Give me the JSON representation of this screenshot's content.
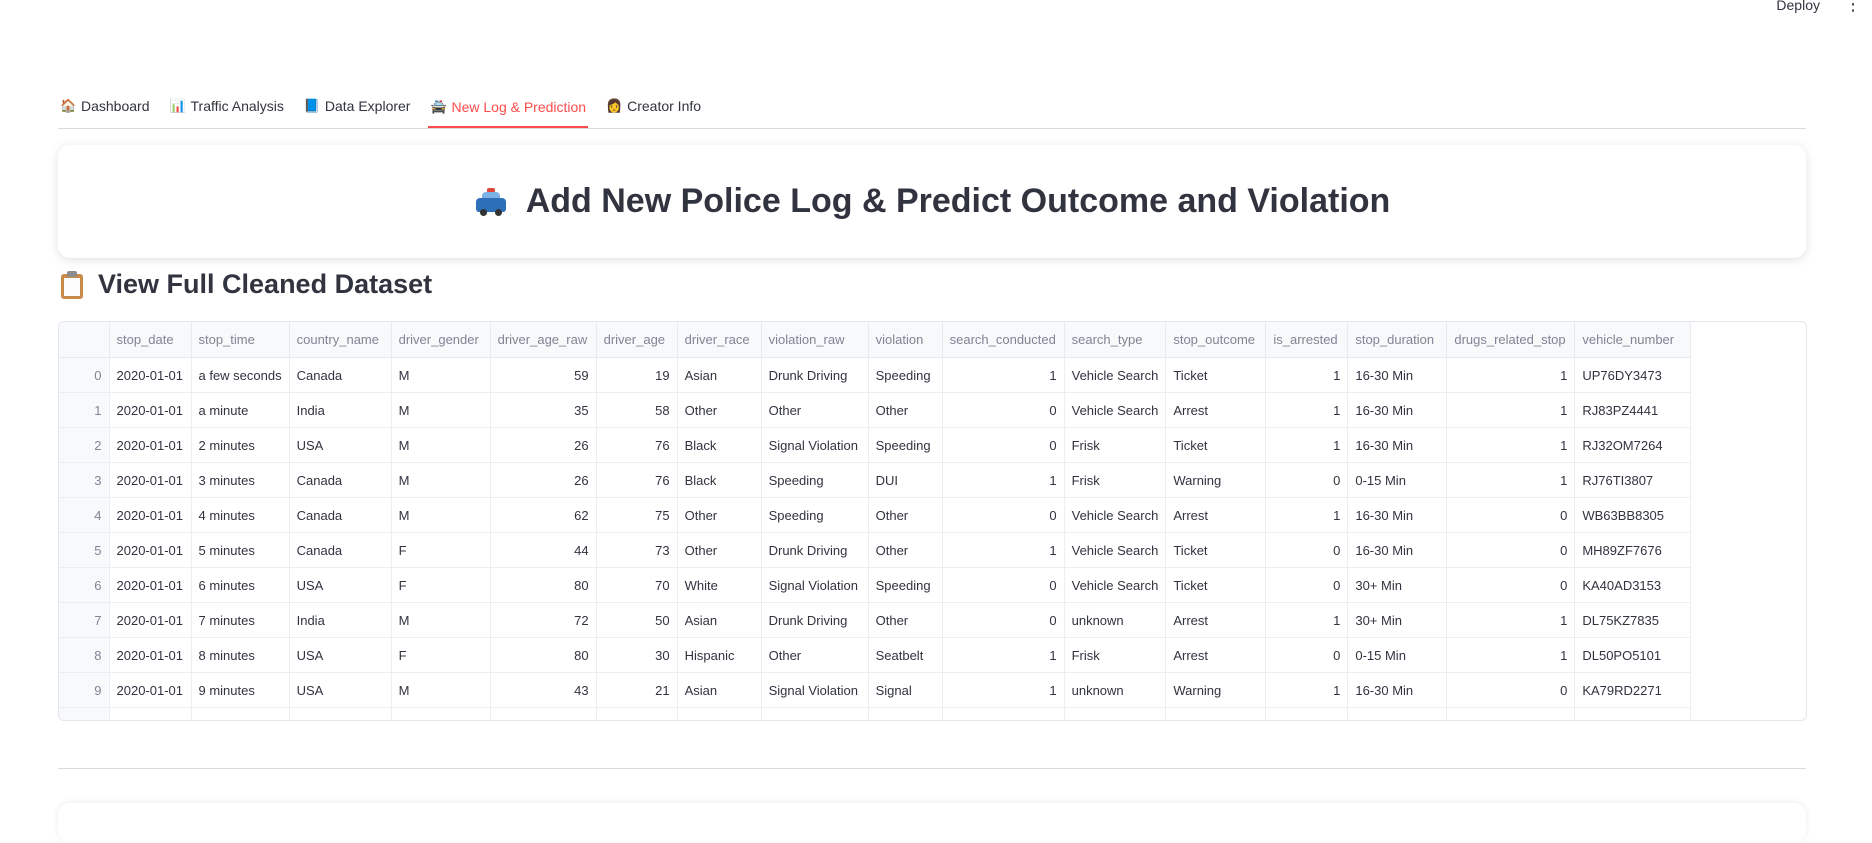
{
  "topbar": {
    "deploy_label": "Deploy",
    "menu_icon": "more-vertical-icon"
  },
  "tabs": [
    {
      "label": "Dashboard",
      "icon": "🏠"
    },
    {
      "label": "Traffic Analysis",
      "icon": "📊"
    },
    {
      "label": "Data Explorer",
      "icon": "📘"
    },
    {
      "label": "New Log & Prediction",
      "icon": "🚔",
      "active": true
    },
    {
      "label": "Creator Info",
      "icon": "👩"
    }
  ],
  "header": {
    "title": "Add New Police Log & Predict Outcome and Violation",
    "icon": "police-car-icon"
  },
  "section": {
    "title": "View Full Cleaned Dataset",
    "icon": "clipboard-icon"
  },
  "table": {
    "columns": [
      "",
      "stop_date",
      "stop_time",
      "country_name",
      "driver_gender",
      "driver_age_raw",
      "driver_age",
      "driver_race",
      "violation_raw",
      "violation",
      "search_conducted",
      "search_type",
      "stop_outcome",
      "is_arrested",
      "stop_duration",
      "drugs_related_stop",
      "vehicle_number"
    ],
    "rows": [
      [
        "0",
        "2020-01-01",
        "a few seconds",
        "Canada",
        "M",
        "59",
        "19",
        "Asian",
        "Drunk Driving",
        "Speeding",
        "1",
        "Vehicle Search",
        "Ticket",
        "1",
        "16-30 Min",
        "1",
        "UP76DY3473"
      ],
      [
        "1",
        "2020-01-01",
        "a minute",
        "India",
        "M",
        "35",
        "58",
        "Other",
        "Other",
        "Other",
        "0",
        "Vehicle Search",
        "Arrest",
        "1",
        "16-30 Min",
        "1",
        "RJ83PZ4441"
      ],
      [
        "2",
        "2020-01-01",
        "2 minutes",
        "USA",
        "M",
        "26",
        "76",
        "Black",
        "Signal Violation",
        "Speeding",
        "0",
        "Frisk",
        "Ticket",
        "1",
        "16-30 Min",
        "1",
        "RJ32OM7264"
      ],
      [
        "3",
        "2020-01-01",
        "3 minutes",
        "Canada",
        "M",
        "26",
        "76",
        "Black",
        "Speeding",
        "DUI",
        "1",
        "Frisk",
        "Warning",
        "0",
        "0-15 Min",
        "1",
        "RJ76TI3807"
      ],
      [
        "4",
        "2020-01-01",
        "4 minutes",
        "Canada",
        "M",
        "62",
        "75",
        "Other",
        "Speeding",
        "Other",
        "0",
        "Vehicle Search",
        "Arrest",
        "1",
        "16-30 Min",
        "0",
        "WB63BB8305"
      ],
      [
        "5",
        "2020-01-01",
        "5 minutes",
        "Canada",
        "F",
        "44",
        "73",
        "Other",
        "Drunk Driving",
        "Other",
        "1",
        "Vehicle Search",
        "Ticket",
        "0",
        "16-30 Min",
        "0",
        "MH89ZF7676"
      ],
      [
        "6",
        "2020-01-01",
        "6 minutes",
        "USA",
        "F",
        "80",
        "70",
        "White",
        "Signal Violation",
        "Speeding",
        "0",
        "Vehicle Search",
        "Ticket",
        "0",
        "30+ Min",
        "0",
        "KA40AD3153"
      ],
      [
        "7",
        "2020-01-01",
        "7 minutes",
        "India",
        "M",
        "72",
        "50",
        "Asian",
        "Drunk Driving",
        "Other",
        "0",
        "unknown",
        "Arrest",
        "1",
        "30+ Min",
        "1",
        "DL75KZ7835"
      ],
      [
        "8",
        "2020-01-01",
        "8 minutes",
        "USA",
        "F",
        "80",
        "30",
        "Hispanic",
        "Other",
        "Seatbelt",
        "1",
        "Frisk",
        "Arrest",
        "0",
        "0-15 Min",
        "1",
        "DL50PO5101"
      ],
      [
        "9",
        "2020-01-01",
        "9 minutes",
        "USA",
        "M",
        "43",
        "21",
        "Asian",
        "Signal Violation",
        "Signal",
        "1",
        "unknown",
        "Warning",
        "1",
        "16-30 Min",
        "0",
        "KA79RD2271"
      ]
    ]
  }
}
